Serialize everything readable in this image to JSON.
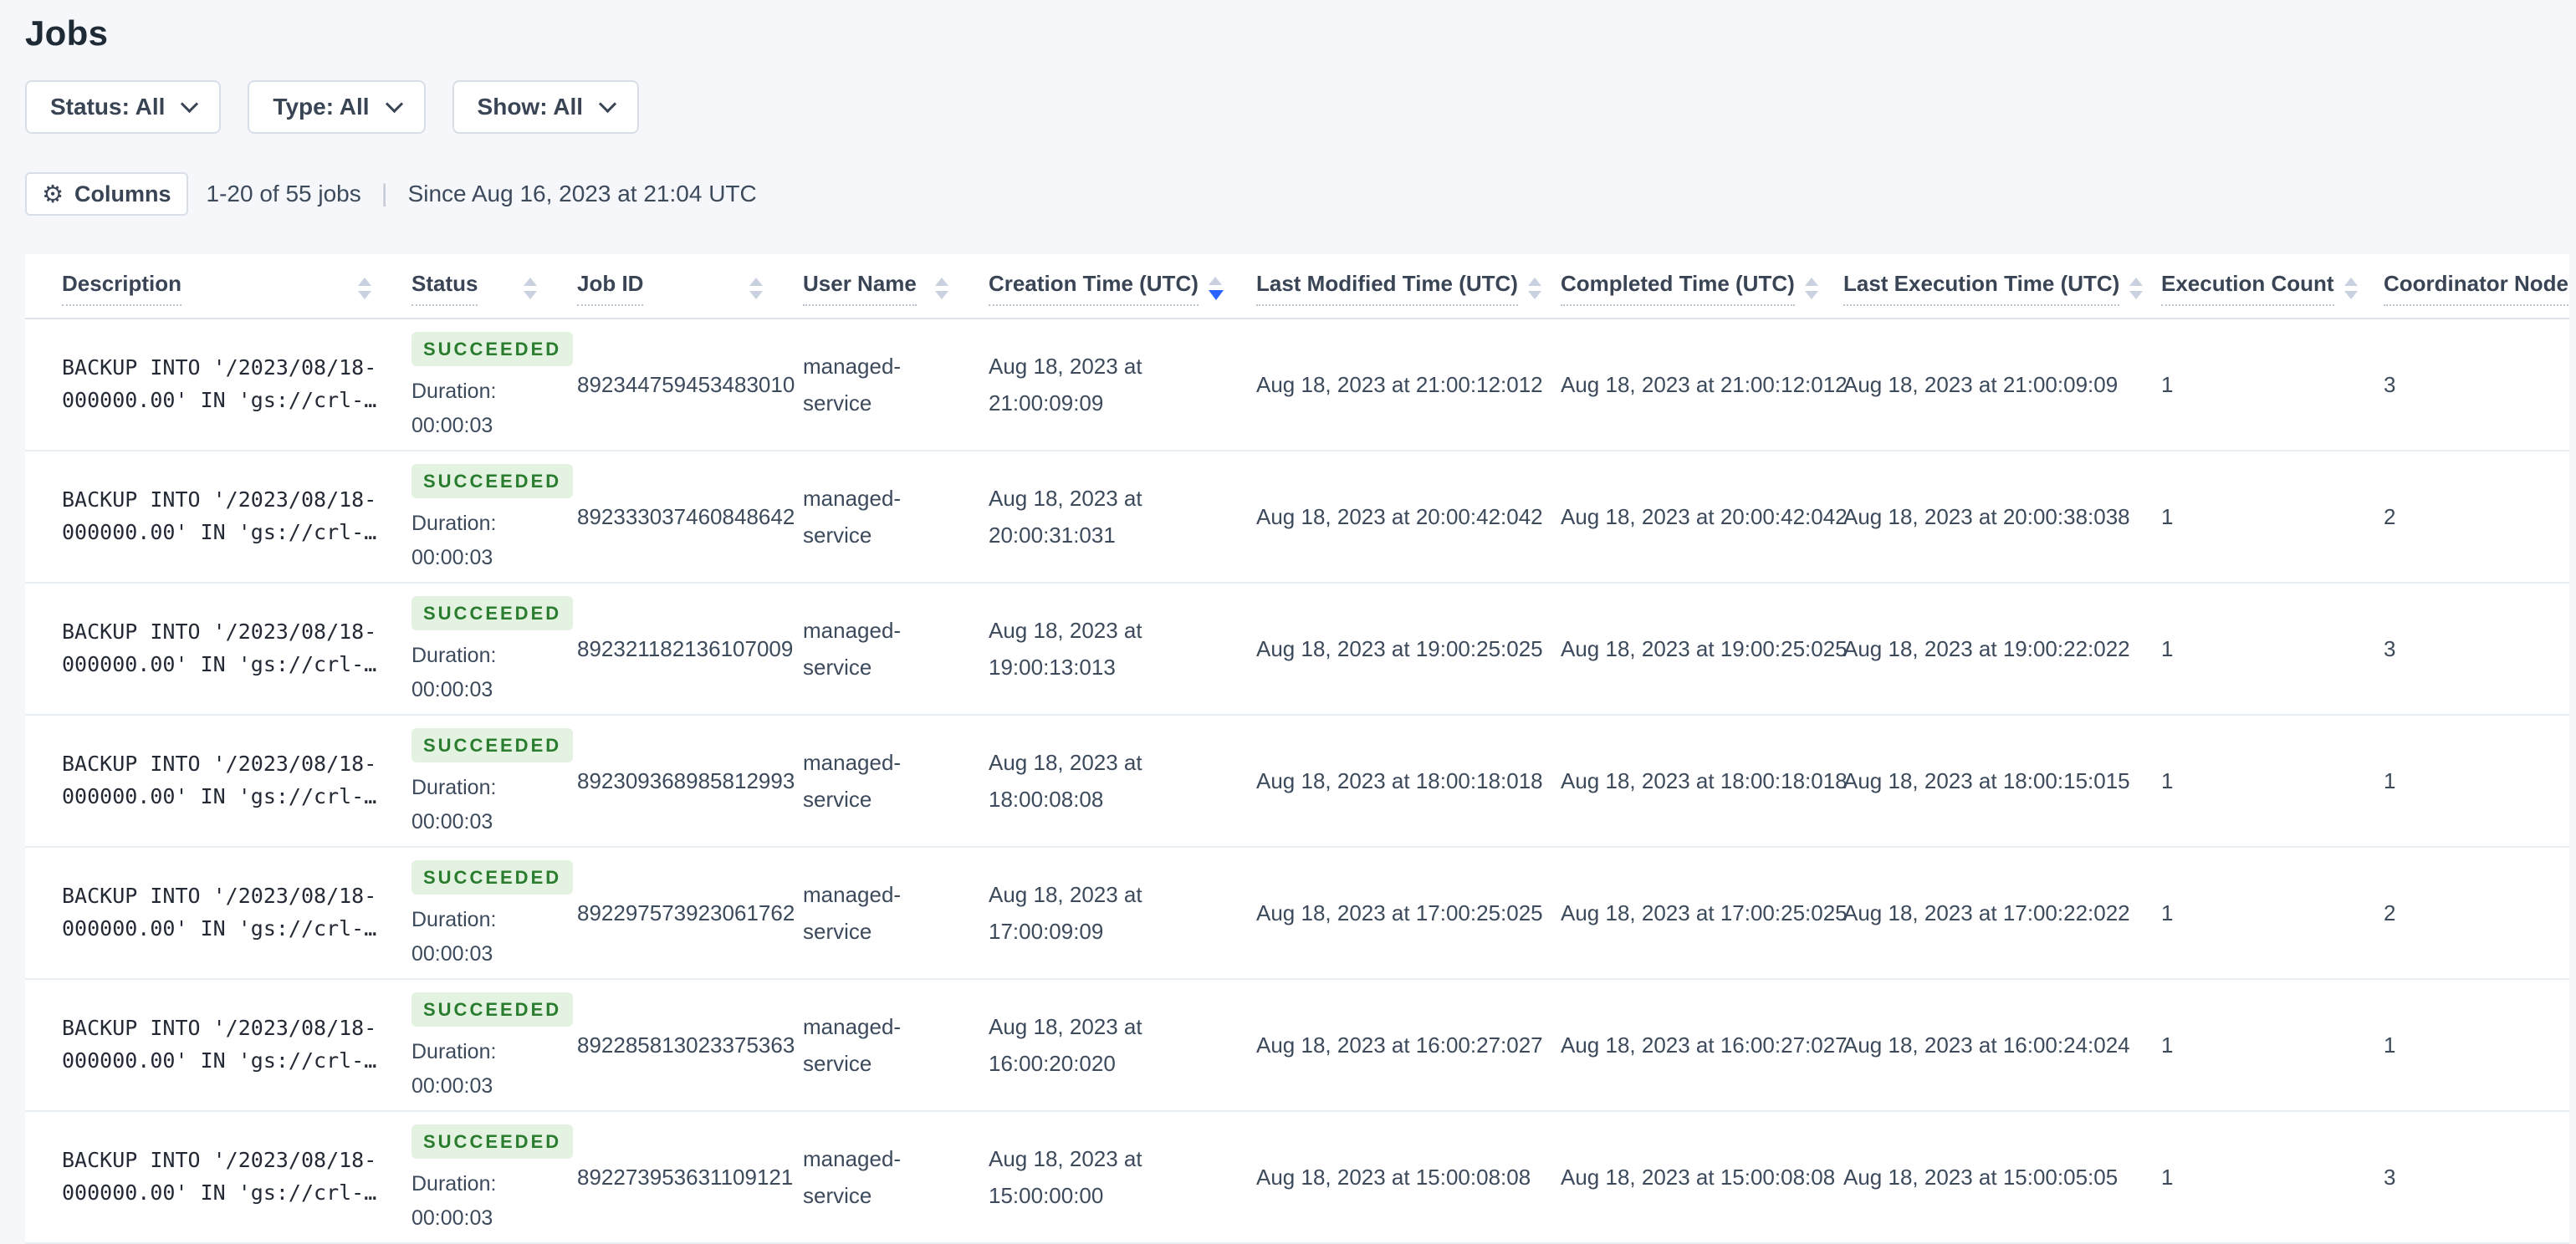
{
  "page": {
    "title": "Jobs"
  },
  "colors": {
    "accent_blue": "#2962ff",
    "badge_green_bg": "#e4f2e2",
    "badge_green_text": "#2a7c2e",
    "background": "#f5f7fa"
  },
  "filters": [
    {
      "name": "status-filter",
      "label": "Status: All"
    },
    {
      "name": "type-filter",
      "label": "Type: All"
    },
    {
      "name": "show-filter",
      "label": "Show: All"
    }
  ],
  "toolbar": {
    "columns_label": "Columns",
    "gear_icon": "⚙",
    "count_text": "1-20 of 55 jobs",
    "separator": "|",
    "since_text": "Since Aug 16, 2023 at 21:04 UTC"
  },
  "table": {
    "columns": [
      {
        "name": "description",
        "label": "Description",
        "sort": null
      },
      {
        "name": "status",
        "label": "Status",
        "sort": null
      },
      {
        "name": "job-id",
        "label": "Job ID",
        "sort": null
      },
      {
        "name": "user-name",
        "label": "User Name",
        "sort": null
      },
      {
        "name": "creation-time",
        "label": "Creation Time (UTC)",
        "sort": "desc"
      },
      {
        "name": "last-modified-time",
        "label": "Last Modified Time (UTC)",
        "sort": null
      },
      {
        "name": "completed-time",
        "label": "Completed Time (UTC)",
        "sort": null
      },
      {
        "name": "last-execution-time",
        "label": "Last Execution Time (UTC)",
        "sort": null
      },
      {
        "name": "execution-count",
        "label": "Execution Count",
        "sort": null
      },
      {
        "name": "coordinator-node",
        "label": "Coordinator Node",
        "sort": null
      }
    ],
    "rows": [
      {
        "description_line1": "BACKUP INTO '/2023/08/18-",
        "description_line2": "000000.00' IN 'gs://crl-…",
        "status": "SUCCEEDED",
        "duration_label": "Duration:",
        "duration": "00:00:03",
        "job_id": "892344759453483010",
        "user_name": "managed-service",
        "creation_time": "Aug 18, 2023 at 21:00:09:09",
        "last_modified": "Aug 18, 2023 at 21:00:12:012",
        "completed": "Aug 18, 2023 at 21:00:12:012",
        "last_execution": "Aug 18, 2023 at 21:00:09:09",
        "execution_count": "1",
        "coordinator_node": "3"
      },
      {
        "description_line1": "BACKUP INTO '/2023/08/18-",
        "description_line2": "000000.00' IN 'gs://crl-…",
        "status": "SUCCEEDED",
        "duration_label": "Duration:",
        "duration": "00:00:03",
        "job_id": "892333037460848642",
        "user_name": "managed-service",
        "creation_time": "Aug 18, 2023 at 20:00:31:031",
        "last_modified": "Aug 18, 2023 at 20:00:42:042",
        "completed": "Aug 18, 2023 at 20:00:42:042",
        "last_execution": "Aug 18, 2023 at 20:00:38:038",
        "execution_count": "1",
        "coordinator_node": "2"
      },
      {
        "description_line1": "BACKUP INTO '/2023/08/18-",
        "description_line2": "000000.00' IN 'gs://crl-…",
        "status": "SUCCEEDED",
        "duration_label": "Duration:",
        "duration": "00:00:03",
        "job_id": "892321182136107009",
        "user_name": "managed-service",
        "creation_time": "Aug 18, 2023 at 19:00:13:013",
        "last_modified": "Aug 18, 2023 at 19:00:25:025",
        "completed": "Aug 18, 2023 at 19:00:25:025",
        "last_execution": "Aug 18, 2023 at 19:00:22:022",
        "execution_count": "1",
        "coordinator_node": "3"
      },
      {
        "description_line1": "BACKUP INTO '/2023/08/18-",
        "description_line2": "000000.00' IN 'gs://crl-…",
        "status": "SUCCEEDED",
        "duration_label": "Duration:",
        "duration": "00:00:03",
        "job_id": "892309368985812993",
        "user_name": "managed-service",
        "creation_time": "Aug 18, 2023 at 18:00:08:08",
        "last_modified": "Aug 18, 2023 at 18:00:18:018",
        "completed": "Aug 18, 2023 at 18:00:18:018",
        "last_execution": "Aug 18, 2023 at 18:00:15:015",
        "execution_count": "1",
        "coordinator_node": "1"
      },
      {
        "description_line1": "BACKUP INTO '/2023/08/18-",
        "description_line2": "000000.00' IN 'gs://crl-…",
        "status": "SUCCEEDED",
        "duration_label": "Duration:",
        "duration": "00:00:03",
        "job_id": "892297573923061762",
        "user_name": "managed-service",
        "creation_time": "Aug 18, 2023 at 17:00:09:09",
        "last_modified": "Aug 18, 2023 at 17:00:25:025",
        "completed": "Aug 18, 2023 at 17:00:25:025",
        "last_execution": "Aug 18, 2023 at 17:00:22:022",
        "execution_count": "1",
        "coordinator_node": "2"
      },
      {
        "description_line1": "BACKUP INTO '/2023/08/18-",
        "description_line2": "000000.00' IN 'gs://crl-…",
        "status": "SUCCEEDED",
        "duration_label": "Duration:",
        "duration": "00:00:03",
        "job_id": "892285813023375363",
        "user_name": "managed-service",
        "creation_time": "Aug 18, 2023 at 16:00:20:020",
        "last_modified": "Aug 18, 2023 at 16:00:27:027",
        "completed": "Aug 18, 2023 at 16:00:27:027",
        "last_execution": "Aug 18, 2023 at 16:00:24:024",
        "execution_count": "1",
        "coordinator_node": "1"
      },
      {
        "description_line1": "BACKUP INTO '/2023/08/18-",
        "description_line2": "000000.00' IN 'gs://crl-…",
        "status": "SUCCEEDED",
        "duration_label": "Duration:",
        "duration": "00:00:03",
        "job_id": "892273953631109121",
        "user_name": "managed-service",
        "creation_time": "Aug 18, 2023 at 15:00:00:00",
        "last_modified": "Aug 18, 2023 at 15:00:08:08",
        "completed": "Aug 18, 2023 at 15:00:08:08",
        "last_execution": "Aug 18, 2023 at 15:00:05:05",
        "execution_count": "1",
        "coordinator_node": "3"
      }
    ]
  }
}
